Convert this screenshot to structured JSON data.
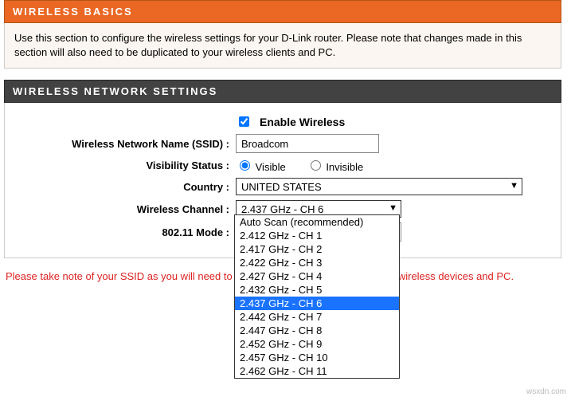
{
  "basics": {
    "title": "WIRELESS BASICS",
    "description": "Use this section to configure the wireless settings for your D-Link router. Please note that changes made in this section will also need to be duplicated to your wireless clients and PC."
  },
  "settings": {
    "title": "WIRELESS NETWORK SETTINGS",
    "enable_label": "Enable Wireless",
    "enable_checked": true,
    "ssid_label": "Wireless Network Name (SSID) :",
    "ssid_value": "Broadcom",
    "visibility_label": "Visibility Status :",
    "visibility_visible": "Visible",
    "visibility_invisible": "Invisible",
    "country_label": "Country :",
    "country_value": "UNITED STATES",
    "channel_label": "Wireless Channel :",
    "channel_value": "2.437 GHz - CH 6",
    "mode_label": "802.11 Mode :",
    "channel_options": [
      "Auto Scan (recommended)",
      "2.412 GHz - CH 1",
      "2.417 GHz - CH 2",
      "2.422 GHz - CH 3",
      "2.427 GHz - CH 4",
      "2.432 GHz - CH 5",
      "2.437 GHz - CH 6",
      "2.442 GHz - CH 7",
      "2.447 GHz - CH 8",
      "2.452 GHz - CH 9",
      "2.457 GHz - CH 10",
      "2.462 GHz - CH 11"
    ],
    "channel_selected_index": 6
  },
  "footer_note": "Please take note of your SSID as you will need to duplicate the same settings to your wireless devices and PC.",
  "watermark": "wsxdn.com"
}
